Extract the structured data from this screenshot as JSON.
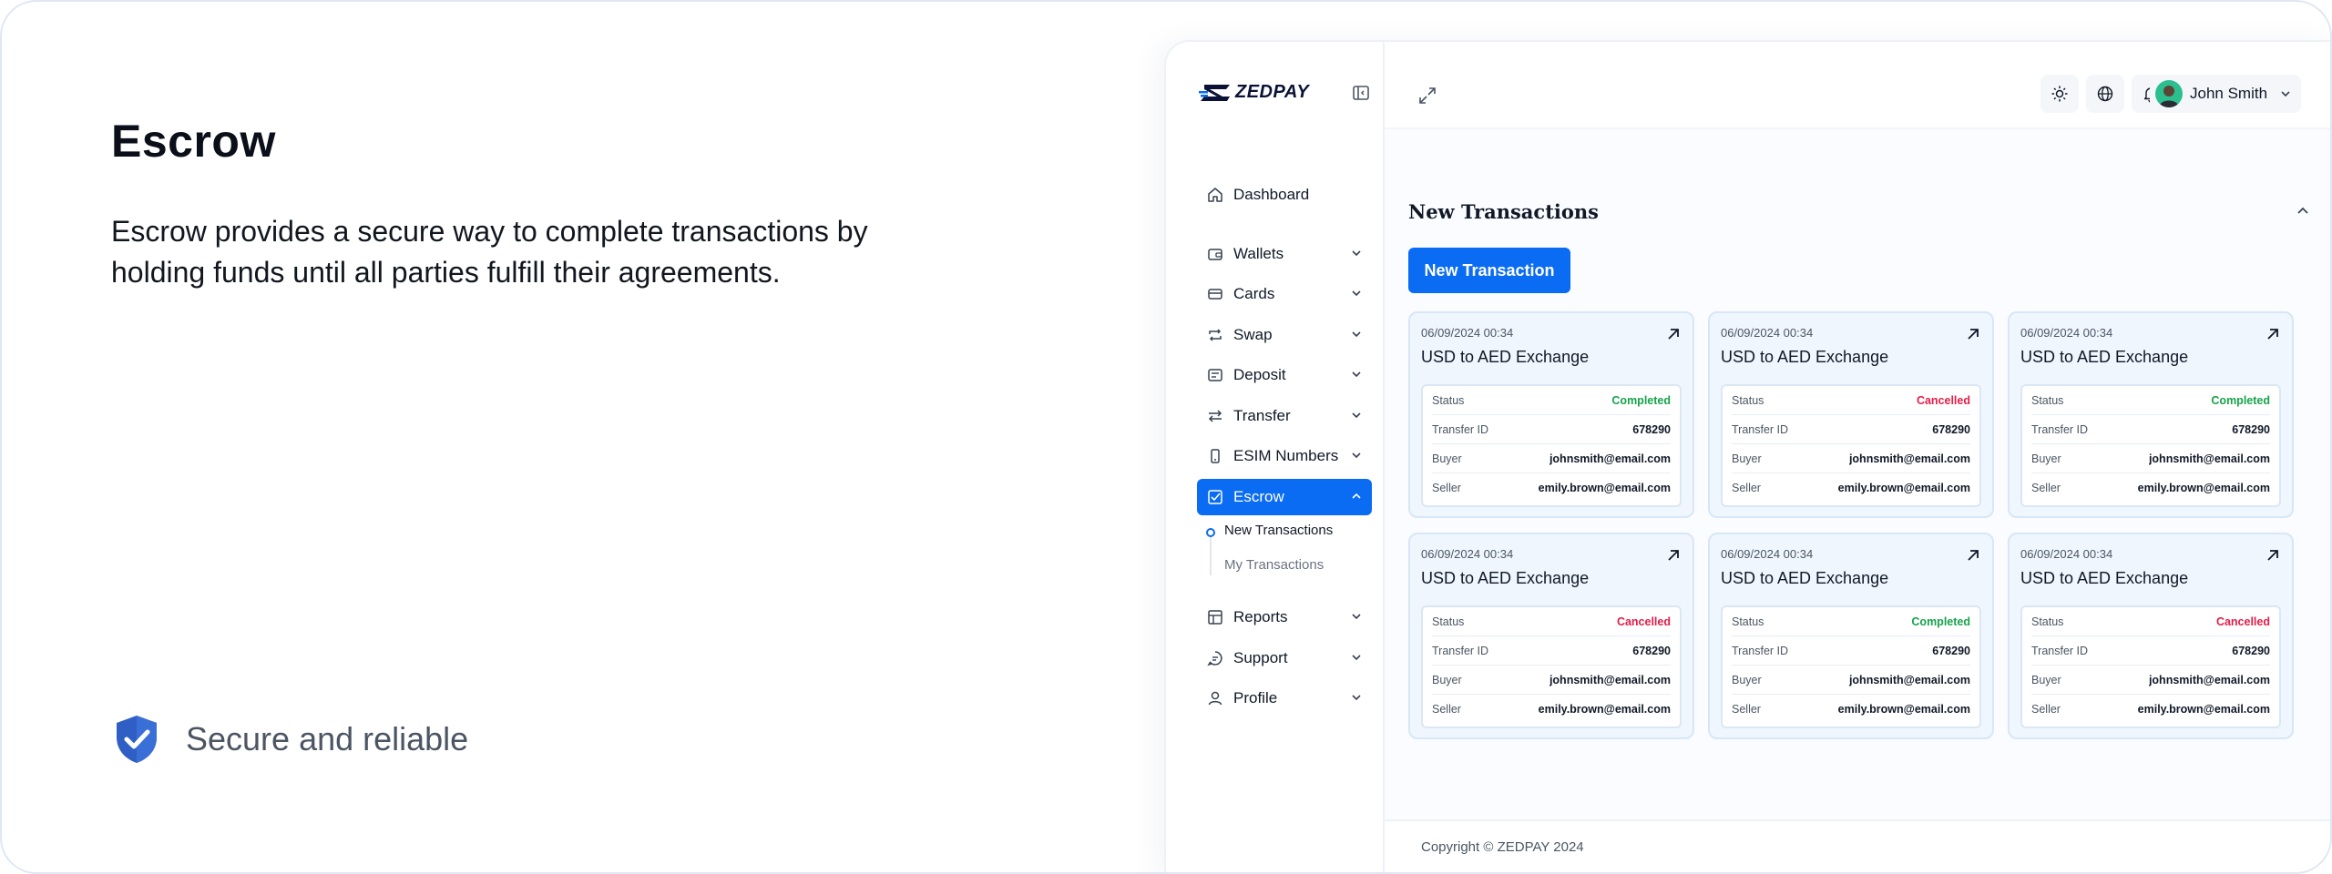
{
  "promo": {
    "title": "Escrow",
    "description": "Escrow provides a secure way to complete transactions by holding funds until all parties fulfill their agreements.",
    "badge": "Secure and reliable",
    "badge_icon": "shield-check-icon"
  },
  "brand": {
    "name": "ZEDPAY",
    "accent": "#0a6cf2"
  },
  "sidebar": {
    "items": [
      {
        "label": "Dashboard",
        "icon": "home-icon"
      },
      {
        "label": "Wallets",
        "icon": "wallet-icon"
      },
      {
        "label": "Cards",
        "icon": "card-icon"
      },
      {
        "label": "Swap",
        "icon": "swap-icon"
      },
      {
        "label": "Deposit",
        "icon": "deposit-icon"
      },
      {
        "label": "Transfer",
        "icon": "transfer-icon"
      },
      {
        "label": "ESIM Numbers",
        "icon": "phone-icon"
      },
      {
        "label": "Escrow",
        "icon": "escrow-icon",
        "active": true
      },
      {
        "label": "Reports",
        "icon": "reports-icon"
      },
      {
        "label": "Support",
        "icon": "support-icon"
      },
      {
        "label": "Profile",
        "icon": "user-icon"
      }
    ],
    "escrow_sub": [
      "New Transactions",
      "My Transactions"
    ]
  },
  "header": {
    "user_name": "John Smith"
  },
  "main": {
    "section_title": "New Transactions",
    "new_button": "New Transaction",
    "labels": {
      "status": "Status",
      "transfer_id": "Transfer ID",
      "buyer": "Buyer",
      "seller": "Seller"
    },
    "cards": [
      {
        "date": "06/09/2024 00:34",
        "title": "USD to AED Exchange",
        "status": "Completed",
        "transfer_id": "678290",
        "buyer": "johnsmith@email.com",
        "seller": "emily.brown@email.com"
      },
      {
        "date": "06/09/2024 00:34",
        "title": "USD to AED Exchange",
        "status": "Cancelled",
        "transfer_id": "678290",
        "buyer": "johnsmith@email.com",
        "seller": "emily.brown@email.com"
      },
      {
        "date": "06/09/2024 00:34",
        "title": "USD to AED Exchange",
        "status": "Completed",
        "transfer_id": "678290",
        "buyer": "johnsmith@email.com",
        "seller": "emily.brown@email.com"
      },
      {
        "date": "06/09/2024 00:34",
        "title": "USD to AED Exchange",
        "status": "Cancelled",
        "transfer_id": "678290",
        "buyer": "johnsmith@email.com",
        "seller": "emily.brown@email.com"
      },
      {
        "date": "06/09/2024 00:34",
        "title": "USD to AED Exchange",
        "status": "Completed",
        "transfer_id": "678290",
        "buyer": "johnsmith@email.com",
        "seller": "emily.brown@email.com"
      },
      {
        "date": "06/09/2024 00:34",
        "title": "USD to AED Exchange",
        "status": "Cancelled",
        "transfer_id": "678290",
        "buyer": "johnsmith@email.com",
        "seller": "emily.brown@email.com"
      }
    ]
  },
  "footer": {
    "copyright": "Copyright © ZEDPAY 2024"
  }
}
